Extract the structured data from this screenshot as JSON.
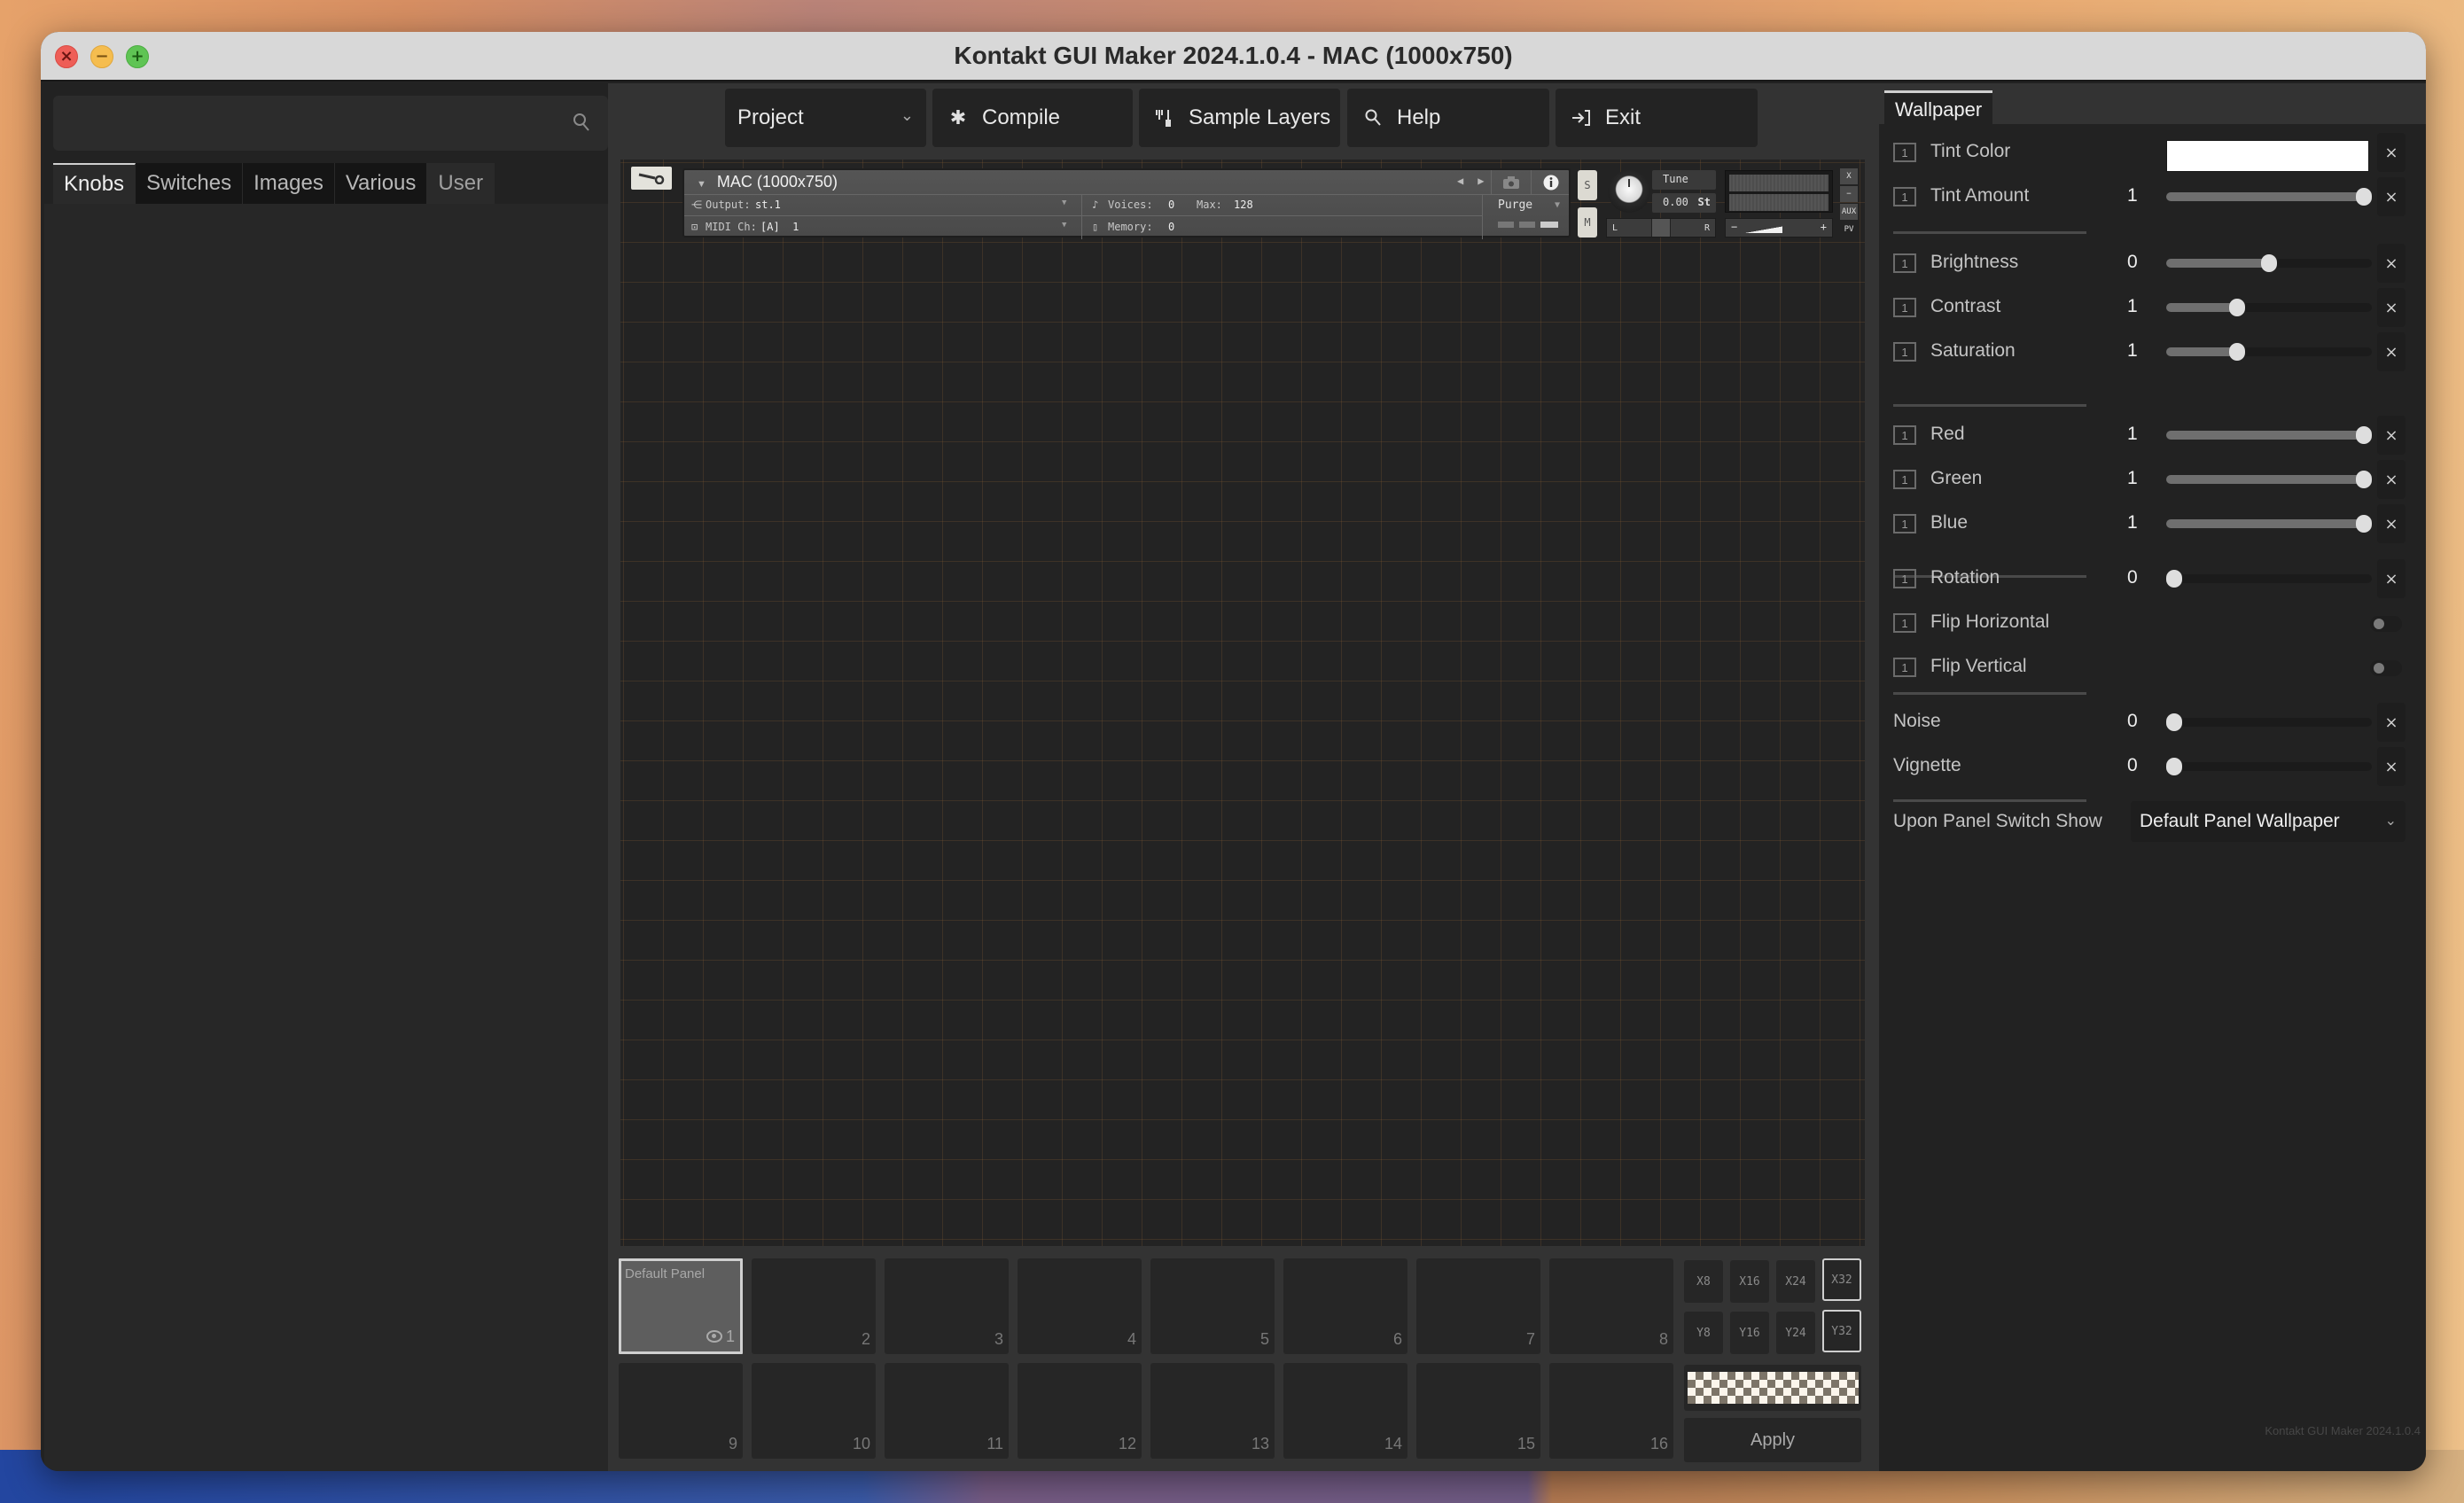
{
  "window": {
    "title": "Kontakt GUI Maker 2024.1.0.4 - MAC (1000x750)",
    "traffic_lights": {
      "close": "×",
      "minimize": "−",
      "maximize": "+"
    }
  },
  "left_panel": {
    "search": {
      "value": "",
      "placeholder": "",
      "icon": "search-icon"
    },
    "tabs": [
      {
        "label": "Knobs",
        "active": true
      },
      {
        "label": "Switches",
        "active": false
      },
      {
        "label": "Images",
        "active": false
      },
      {
        "label": "Various",
        "active": false
      },
      {
        "label": "User",
        "active": false
      }
    ]
  },
  "toolbar": {
    "project": {
      "label": "Project",
      "icon": "chevron-down-icon"
    },
    "compile": {
      "label": "Compile",
      "icon": "gear-icon"
    },
    "sample_layers": {
      "label": "Sample Layers",
      "icon": "sample-layers-icon"
    },
    "help": {
      "label": "Help",
      "icon": "search-icon"
    },
    "exit": {
      "label": "Exit",
      "icon": "exit-icon"
    }
  },
  "kontakt_header": {
    "instrument_name": "MAC (1000x750)",
    "output_label": "Output:",
    "output_value": "st.1",
    "midi_label": "MIDI Ch:",
    "midi_value": "[A]  1",
    "voices_label": "Voices:",
    "voices_value": "0",
    "max_label": "Max:",
    "max_value": "128",
    "memory_label": "Memory:",
    "memory_value": "0",
    "purge_label": "Purge",
    "solo_label": "S",
    "mute_label": "M",
    "tune_label": "Tune",
    "tune_value": "0.00",
    "tune_unit": "St",
    "pan_left": "L",
    "pan_right": "R",
    "vol_minus": "−",
    "vol_plus": "+",
    "side_buttons": [
      "X",
      "−",
      "AUX",
      "PV"
    ]
  },
  "panels": {
    "cells": [
      {
        "number": "1",
        "name": "Default Panel",
        "active": true,
        "visible": true
      },
      {
        "number": "2"
      },
      {
        "number": "3"
      },
      {
        "number": "4"
      },
      {
        "number": "5"
      },
      {
        "number": "6"
      },
      {
        "number": "7"
      },
      {
        "number": "8"
      },
      {
        "number": "9"
      },
      {
        "number": "10"
      },
      {
        "number": "11"
      },
      {
        "number": "12"
      },
      {
        "number": "13"
      },
      {
        "number": "14"
      },
      {
        "number": "15"
      },
      {
        "number": "16"
      }
    ],
    "grid_x_options": [
      "X8",
      "X16",
      "X24",
      "X32"
    ],
    "grid_x_selected": "X32",
    "grid_y_options": [
      "Y8",
      "Y16",
      "Y24",
      "Y32"
    ],
    "grid_y_selected": "Y32",
    "apply_label": "Apply"
  },
  "right_panel": {
    "tab_label": "Wallpaper",
    "lock_label": "1",
    "tint_color": {
      "label": "Tint Color",
      "value": "#ffffff"
    },
    "sliders": [
      {
        "key": "tint_amount",
        "label": "Tint Amount",
        "value": "1",
        "fraction": 1.0,
        "lock": true
      },
      {
        "key": "brightness",
        "label": "Brightness",
        "value": "0",
        "fraction": 0.5,
        "lock": true
      },
      {
        "key": "contrast",
        "label": "Contrast",
        "value": "1",
        "fraction": 0.33,
        "lock": true
      },
      {
        "key": "saturation",
        "label": "Saturation",
        "value": "1",
        "fraction": 0.33,
        "lock": true
      },
      {
        "key": "red",
        "label": "Red",
        "value": "1",
        "fraction": 1.0,
        "lock": true
      },
      {
        "key": "green",
        "label": "Green",
        "value": "1",
        "fraction": 1.0,
        "lock": true
      },
      {
        "key": "blue",
        "label": "Blue",
        "value": "1",
        "fraction": 1.0,
        "lock": true
      },
      {
        "key": "rotation",
        "label": "Rotation",
        "value": "0",
        "fraction": 0.0,
        "lock": true
      },
      {
        "key": "noise",
        "label": "Noise",
        "value": "0",
        "fraction": 0.0,
        "lock": false
      },
      {
        "key": "vignette",
        "label": "Vignette",
        "value": "0",
        "fraction": 0.0,
        "lock": false
      }
    ],
    "toggles": [
      {
        "key": "flip_horizontal",
        "label": "Flip Horizontal",
        "on": false
      },
      {
        "key": "flip_vertical",
        "label": "Flip Vertical",
        "on": false
      }
    ],
    "reset_label": "×",
    "panel_switch": {
      "label": "Upon Panel Switch Show",
      "value": "Default Panel Wallpaper"
    },
    "footer_version": "Kontakt GUI Maker 2024.1.0.4"
  }
}
